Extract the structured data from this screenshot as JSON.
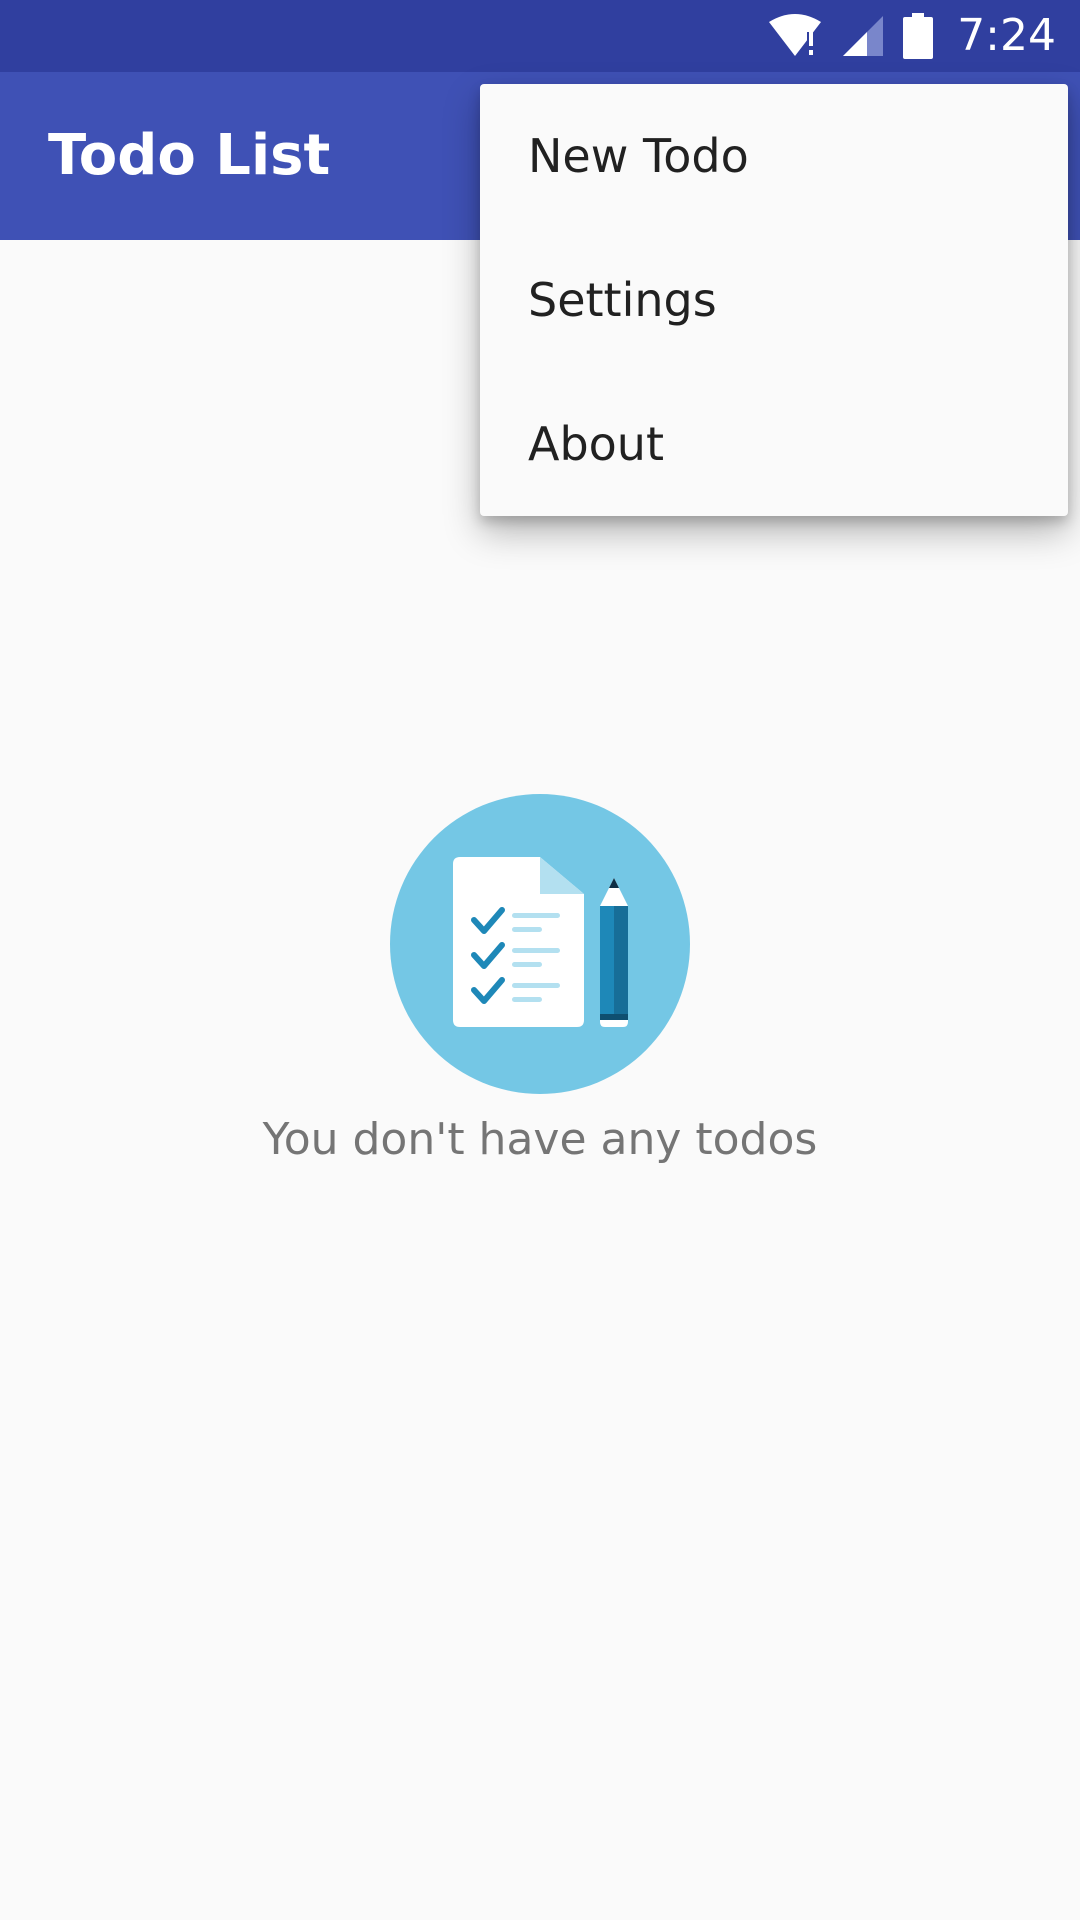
{
  "status_bar": {
    "time": "7:24",
    "icons": [
      "wifi-alert-icon",
      "cell-signal-icon",
      "battery-icon"
    ],
    "background": "#303F9F"
  },
  "app_bar": {
    "title": "Todo List",
    "background": "#3F51B5"
  },
  "overflow_menu": {
    "items": [
      {
        "label": "New Todo"
      },
      {
        "label": "Settings"
      },
      {
        "label": "About"
      }
    ]
  },
  "empty_state": {
    "icon": "todo-checklist-illustration-icon",
    "message": "You don't have any todos",
    "circle_color": "#74C7E5"
  }
}
